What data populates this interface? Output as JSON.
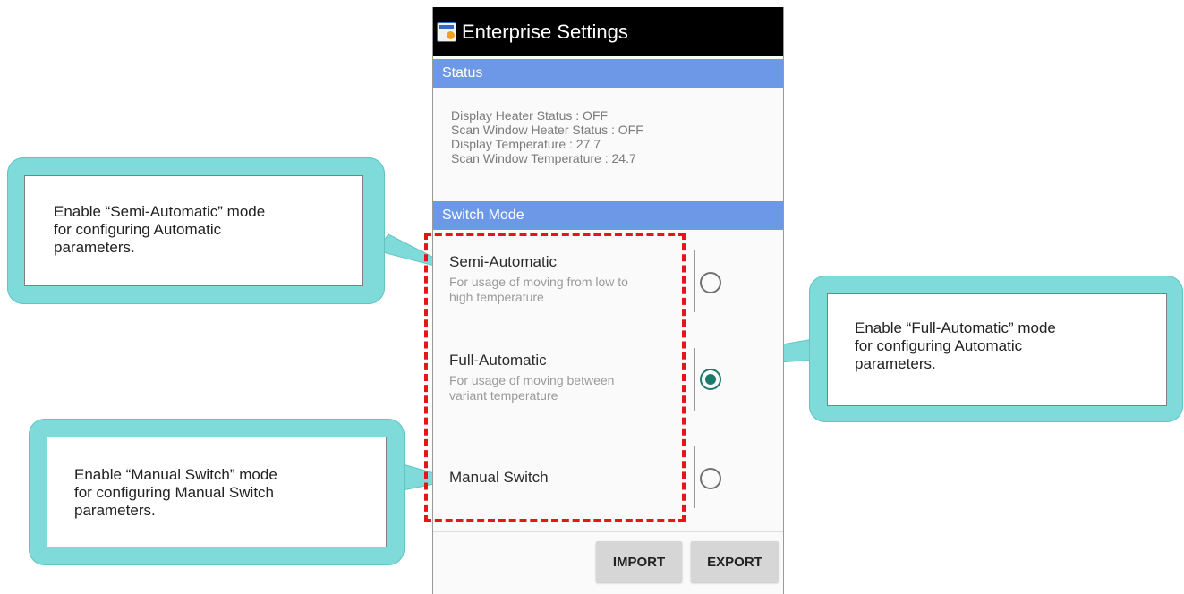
{
  "app": {
    "title": "Enterprise Settings"
  },
  "status": {
    "header": "Status",
    "lines": [
      "Display Heater Status : OFF",
      "Scan Window Heater Status : OFF",
      "Display Temperature : 27.7",
      "Scan Window Temperature : 24.7"
    ]
  },
  "switch_mode": {
    "header": "Switch Mode",
    "options": [
      {
        "title": "Semi-Automatic",
        "description": "For usage of moving from low to high temperature",
        "selected": false
      },
      {
        "title": "Full-Automatic",
        "description": "For usage of moving between variant temperature",
        "selected": true
      },
      {
        "title": "Manual Switch",
        "description": "",
        "selected": false
      }
    ]
  },
  "buttons": {
    "import": "IMPORT",
    "export": "EXPORT"
  },
  "callouts": {
    "semi": [
      "Enable “Semi-Automatic” mode",
      "for configuring Automatic",
      "parameters."
    ],
    "full": [
      "Enable “Full-Automatic” mode",
      "for configuring Automatic",
      "parameters."
    ],
    "manual": [
      "Enable “Manual Switch” mode",
      "for configuring Manual Switch",
      "parameters."
    ]
  },
  "colors": {
    "section_header": "#6d98e8",
    "radio_checked": "#1d7a6b",
    "highlight": "#e8141b",
    "callout_fill": "#7fdada"
  }
}
